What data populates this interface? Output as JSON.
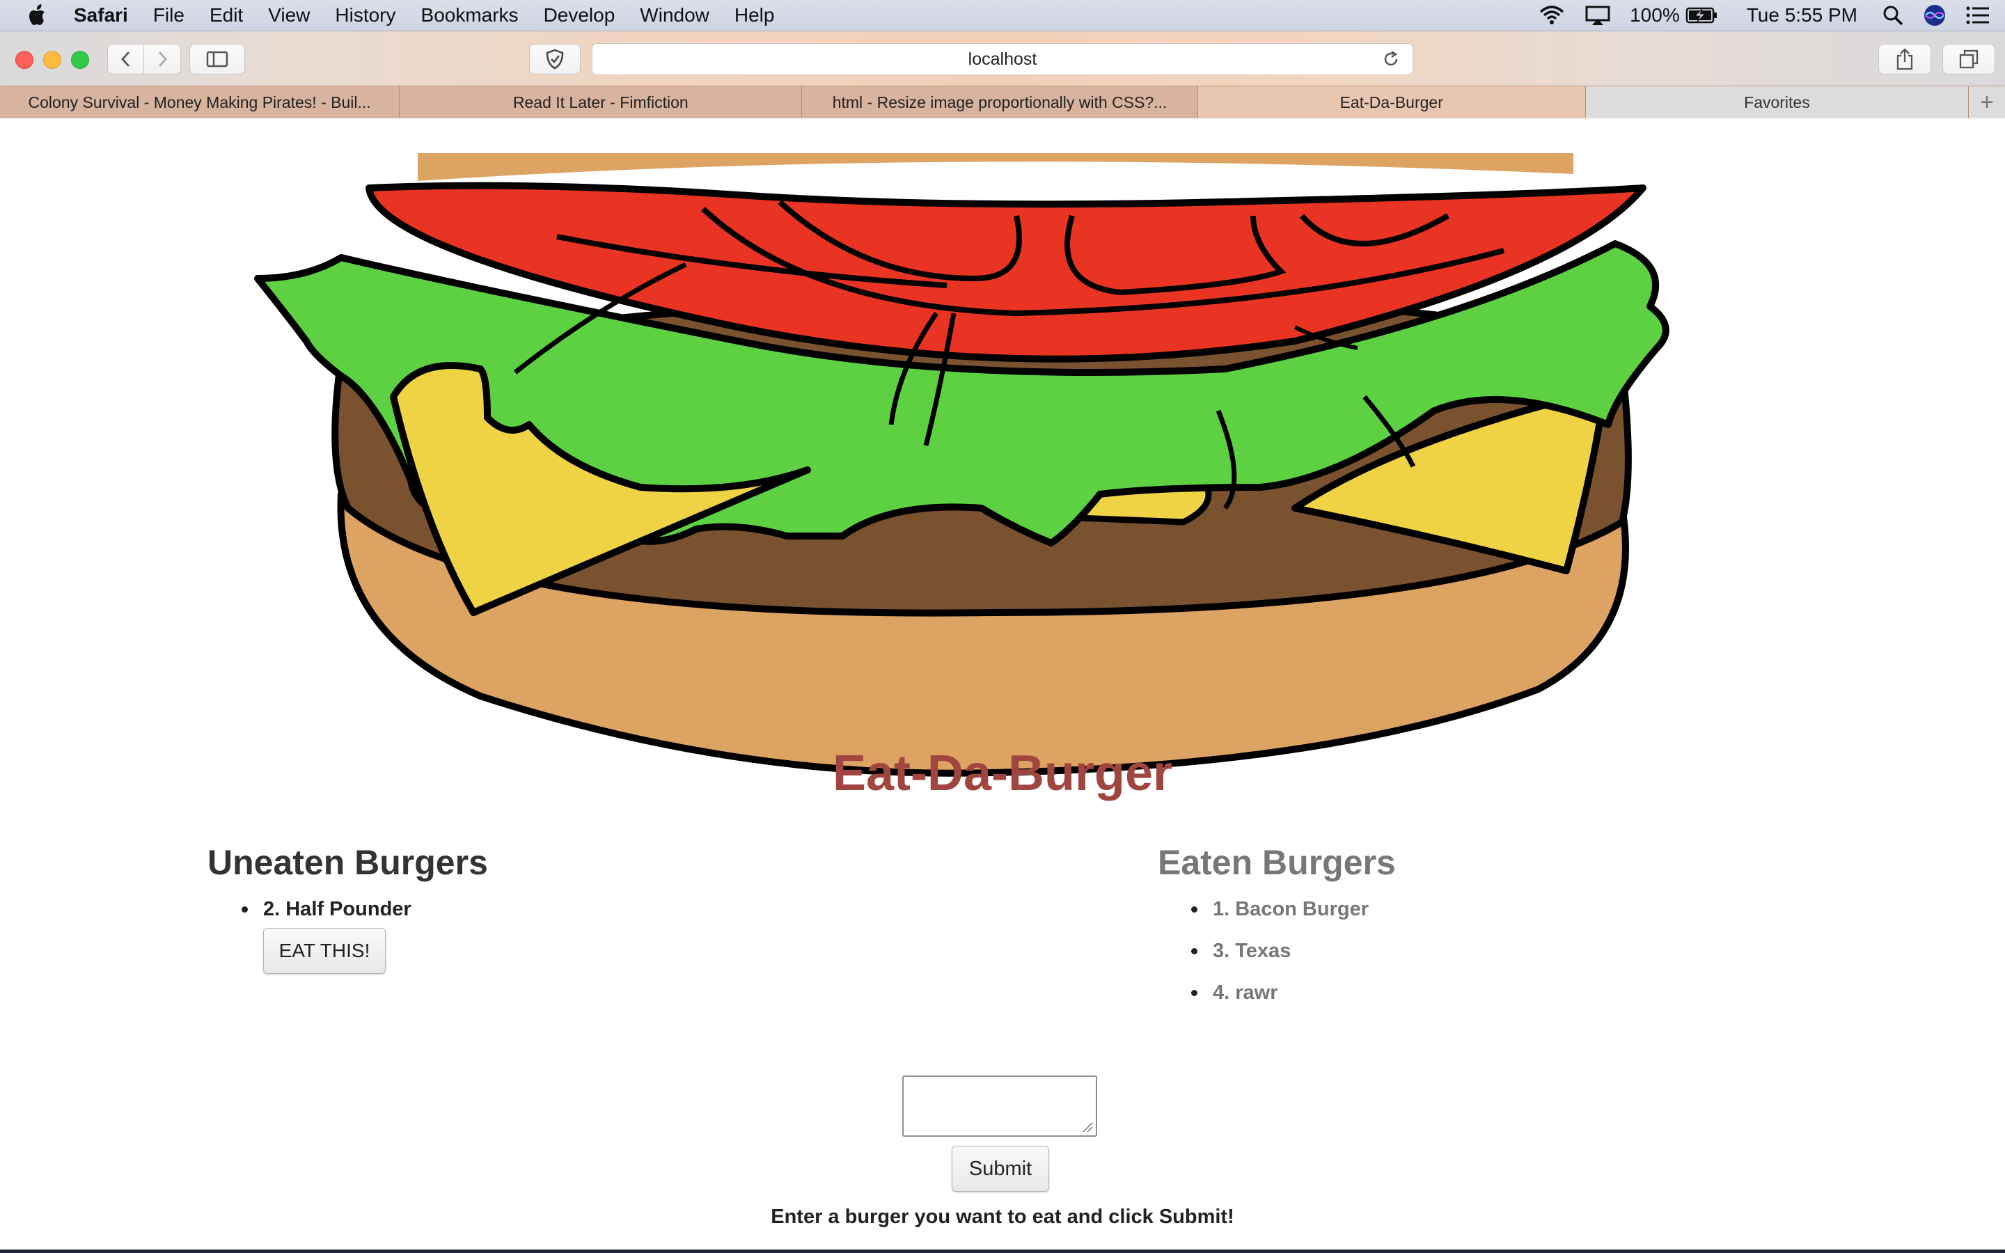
{
  "menubar": {
    "app_name": "Safari",
    "items": [
      "File",
      "Edit",
      "View",
      "History",
      "Bookmarks",
      "Develop",
      "Window",
      "Help"
    ],
    "battery": "100%",
    "clock": "Tue 5:55 PM"
  },
  "toolbar": {
    "url": "localhost"
  },
  "tabs": [
    {
      "title": "Colony Survival - Money Making Pirates! - Buil..."
    },
    {
      "title": "Read It Later - Fimfiction"
    },
    {
      "title": "html - Resize image proportionally with CSS?..."
    },
    {
      "title": "Eat-Da-Burger"
    }
  ],
  "favorites_tab": "Favorites",
  "page": {
    "title": "Eat-Da-Burger",
    "uneaten": {
      "heading": "Uneaten Burgers",
      "items": [
        {
          "label": "2. Half Pounder",
          "button": "EAT THIS!"
        }
      ]
    },
    "eaten": {
      "heading": "Eaten Burgers",
      "items": [
        "1. Bacon Burger",
        "3. Texas",
        "4. rawr"
      ]
    },
    "form": {
      "input_value": "",
      "submit_label": "Submit",
      "instructions": "Enter a burger you want to eat and click Submit!"
    }
  },
  "colors": {
    "title": "#a0453f",
    "bun": "#dda363",
    "lettuce": "#5ed143",
    "tomato": "#e93323",
    "cheese": "#f0d345",
    "patty": "#7a5230"
  }
}
